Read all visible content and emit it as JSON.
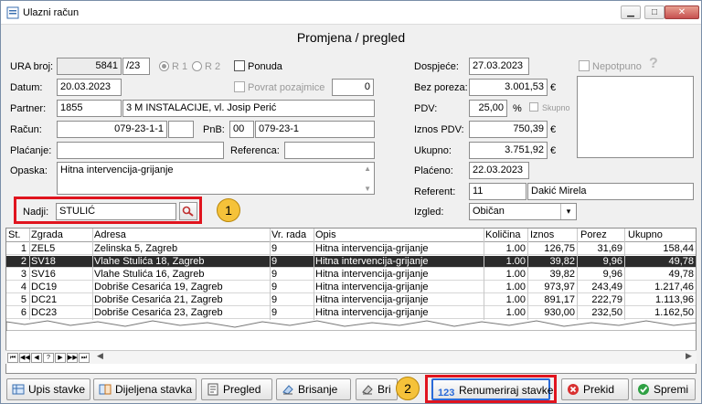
{
  "window": {
    "title": "Ulazni račun"
  },
  "header": {
    "title": "Promjena / pregled"
  },
  "form": {
    "ura_label": "URA broj:",
    "ura_number": "5841",
    "ura_suffix": "/23",
    "r1_label": "R 1",
    "r2_label": "R 2",
    "ponuda_label": "Ponuda",
    "datum_label": "Datum:",
    "datum": "20.03.2023",
    "povrat_label": "Povrat pozajmice",
    "povrat_value": "0",
    "partner_label": "Partner:",
    "partner_id": "1855",
    "partner_name": "3 M INSTALACIJE, vl. Josip Perić",
    "racun_label": "Račun:",
    "racun_number": "079-23-1-1",
    "pnb_label": "PnB:",
    "pnb_model": "00",
    "pnb_number": "079-23-1",
    "placanje_label": "Plaćanje:",
    "placanje_value": "",
    "referenca_label": "Referenca:",
    "referenca_value": "",
    "opaska_label": "Opaska:",
    "opaska_value": "Hitna intervencija-grijanje",
    "nadji_label": "Nadji:",
    "nadji_value": "STULIĆ",
    "dospijece_label": "Dospjeće:",
    "dospijece": "27.03.2023",
    "nepotpuno_label": "Nepotpuno",
    "help_glyph": "?",
    "bez_poreza_label": "Bez poreza:",
    "bez_poreza": "3.001,53",
    "pdv_label": "PDV:",
    "pdv_rate": "25,00",
    "pdv_pct": "%",
    "skupno_label": "Skupno",
    "iznos_pdv_label": "Iznos PDV:",
    "iznos_pdv": "750,39",
    "ukupno_label": "Ukupno:",
    "ukupno": "3.751,92",
    "placeno_label": "Plaćeno:",
    "placeno": "22.03.2023",
    "referent_label": "Referent:",
    "referent_id": "11",
    "referent_name": "Dakić Mirela",
    "izgled_label": "Izgled:",
    "izgled_value": "Običan",
    "currency": "€"
  },
  "callouts": {
    "one": "1",
    "two": "2"
  },
  "grid": {
    "headers": {
      "st": "St.",
      "zgrada": "Zgrada",
      "adresa": "Adresa",
      "vr": "Vr. rada",
      "opis": "Opis",
      "kolicina": "Količina",
      "iznos": "Iznos",
      "porez": "Porez",
      "ukupno": "Ukupno"
    },
    "rows": [
      {
        "st": "1",
        "zgrada": "ZEL5",
        "adresa": "Zelinska 5, Zagreb",
        "vr": "9",
        "opis": "Hitna intervencija-grijanje",
        "kolicina": "1.00",
        "iznos": "126,75",
        "porez": "31,69",
        "ukupno": "158,44"
      },
      {
        "st": "2",
        "zgrada": "SV18",
        "adresa": "Vlahe Stulića 18, Zagreb",
        "vr": "9",
        "opis": "Hitna intervencija-grijanje",
        "kolicina": "1.00",
        "iznos": "39,82",
        "porez": "9,96",
        "ukupno": "49,78"
      },
      {
        "st": "3",
        "zgrada": "SV16",
        "adresa": "Vlahe Stulića 16, Zagreb",
        "vr": "9",
        "opis": "Hitna intervencija-grijanje",
        "kolicina": "1.00",
        "iznos": "39,82",
        "porez": "9,96",
        "ukupno": "49,78"
      },
      {
        "st": "4",
        "zgrada": "DC19",
        "adresa": "Dobriše Cesarića 19, Zagreb",
        "vr": "9",
        "opis": "Hitna intervencija-grijanje",
        "kolicina": "1.00",
        "iznos": "973,97",
        "porez": "243,49",
        "ukupno": "1.217,46"
      },
      {
        "st": "5",
        "zgrada": "DC21",
        "adresa": "Dobriše Cesarića 21, Zagreb",
        "vr": "9",
        "opis": "Hitna intervencija-grijanje",
        "kolicina": "1.00",
        "iznos": "891,17",
        "porez": "222,79",
        "ukupno": "1.113,96"
      },
      {
        "st": "6",
        "zgrada": "DC23",
        "adresa": "Dobriše Cesarića 23, Zagreb",
        "vr": "9",
        "opis": "Hitna intervencija-grijanje",
        "kolicina": "1.00",
        "iznos": "930,00",
        "porez": "232,50",
        "ukupno": "1.162,50"
      }
    ]
  },
  "buttons": {
    "upis": "Upis stavke",
    "dijeljena": "Dijeljena stavka",
    "pregled": "Pregled",
    "brisanje": "Brisanje",
    "bri": "Bri",
    "renumeriraj": "Renumeriraj stavke",
    "prekid": "Prekid",
    "spremi": "Spremi"
  },
  "colors": {
    "highlight": "#e0141e",
    "callout": "#f5c23a",
    "selected_row": "#2b2b2b"
  }
}
